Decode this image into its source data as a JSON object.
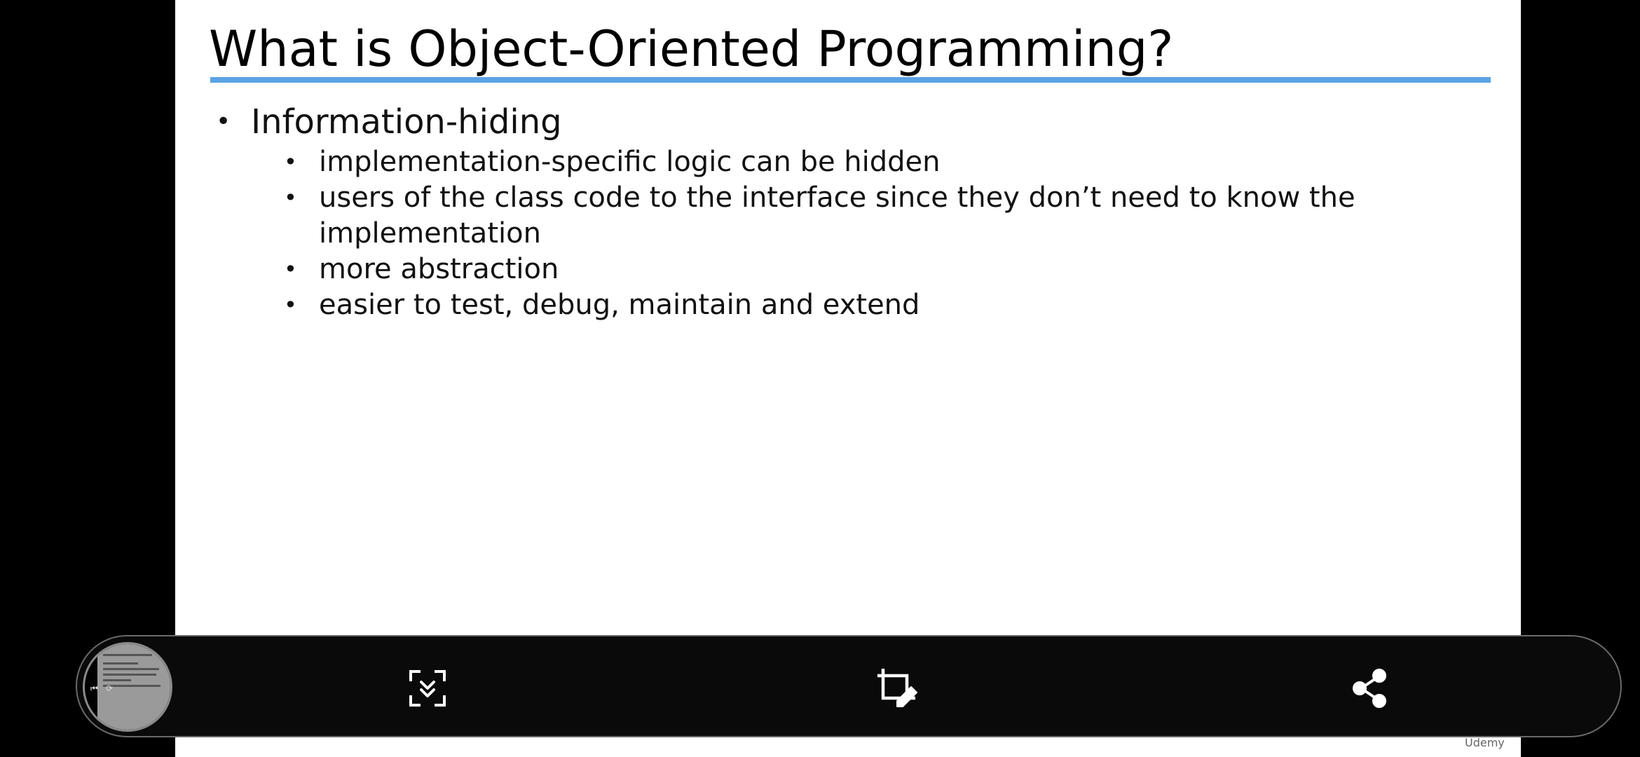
{
  "slide": {
    "title": "What is Object-Oriented Programming?",
    "bullets": [
      {
        "text": "Information-hiding",
        "children": [
          "implementation-specific logic can be hidden",
          "users of the class code to the interface since they don’t need to know the implementation",
          "more abstraction",
          "easier to test, debug, maintain and extend"
        ]
      }
    ],
    "accent_color": "#5ba3e6"
  },
  "toolbar": {
    "icons": [
      "slide-thumbnail",
      "scroll-capture-icon",
      "crop-edit-icon",
      "share-icon"
    ]
  },
  "watermark": {
    "text": "Udemy"
  }
}
